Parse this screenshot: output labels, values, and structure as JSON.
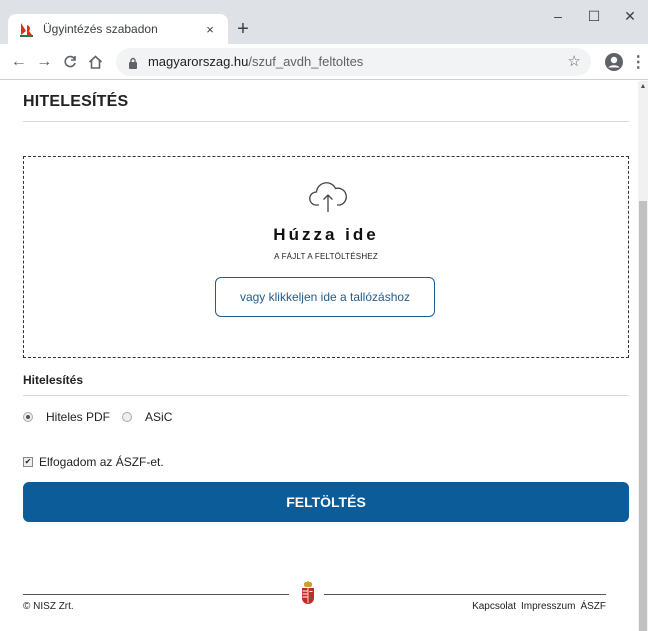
{
  "browser": {
    "tab": {
      "title": "Ügyintézés szabadon",
      "close_glyph": "×"
    },
    "new_tab_glyph": "+",
    "window_controls": {
      "minimize": "–",
      "maximize": "☐",
      "close": "✕"
    },
    "nav": {
      "back": "←",
      "forward": "→",
      "reload": "C",
      "home": "⌂"
    },
    "url": {
      "host": "magyarorszag.hu",
      "path": "/szuf_avdh_feltoltes"
    },
    "star_glyph": "☆",
    "menu_glyph": "⋮"
  },
  "page": {
    "title": "HITELESÍTÉS",
    "dropzone": {
      "icon": "cloud-upload-icon",
      "title": "Húzza ide",
      "subtitle": "A FÁJLT A FELTÖLTÉSHEZ",
      "browse_label": "vagy klikkeljen ide a tallózáshoz"
    },
    "section_label": "Hitelesítés",
    "options": [
      {
        "label": "Hiteles PDF",
        "checked": true
      },
      {
        "label": "ASiC",
        "checked": false
      }
    ],
    "accept": {
      "label": "Elfogadom az ÁSZF-et.",
      "checked": true,
      "check_glyph": "✔"
    },
    "upload_label": "FELTÖLTÉS"
  },
  "footer": {
    "copyright": "© NISZ Zrt.",
    "links": [
      "Kapcsolat",
      "Impresszum",
      "ÁSZF"
    ]
  },
  "colors": {
    "primary": "#0c5c99",
    "browse_border": "#215c8c",
    "favicon_red": "#d93025",
    "favicon_green": "#2e7d32"
  }
}
